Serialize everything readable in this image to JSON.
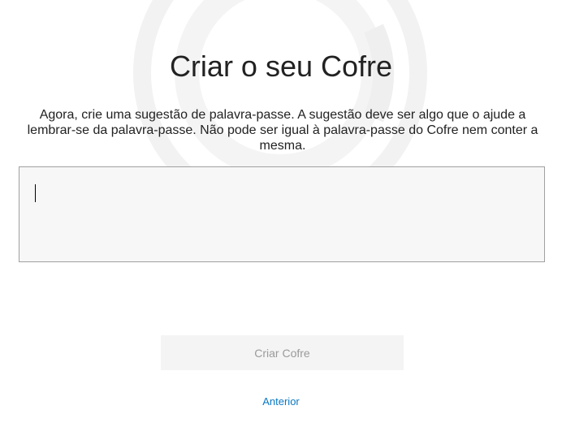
{
  "page": {
    "title": "Criar o seu Cofre",
    "description": "Agora, crie uma sugestão de palavra-passe. A sugestão deve ser algo que o ajude a lembrar-se da palavra-passe. Não pode ser igual à palavra-passe do Cofre nem conter a mesma."
  },
  "hint_field": {
    "value": "",
    "placeholder": ""
  },
  "actions": {
    "create_label": "Criar Cofre",
    "back_label": "Anterior"
  },
  "colors": {
    "link": "#0a78c2",
    "button_bg": "#f4f4f4",
    "button_text": "#9a9a9a",
    "input_bg": "#f7f7f7",
    "input_border": "#a0a0a0"
  },
  "icons": {
    "watermark": "vault-logo-watermark-icon"
  }
}
